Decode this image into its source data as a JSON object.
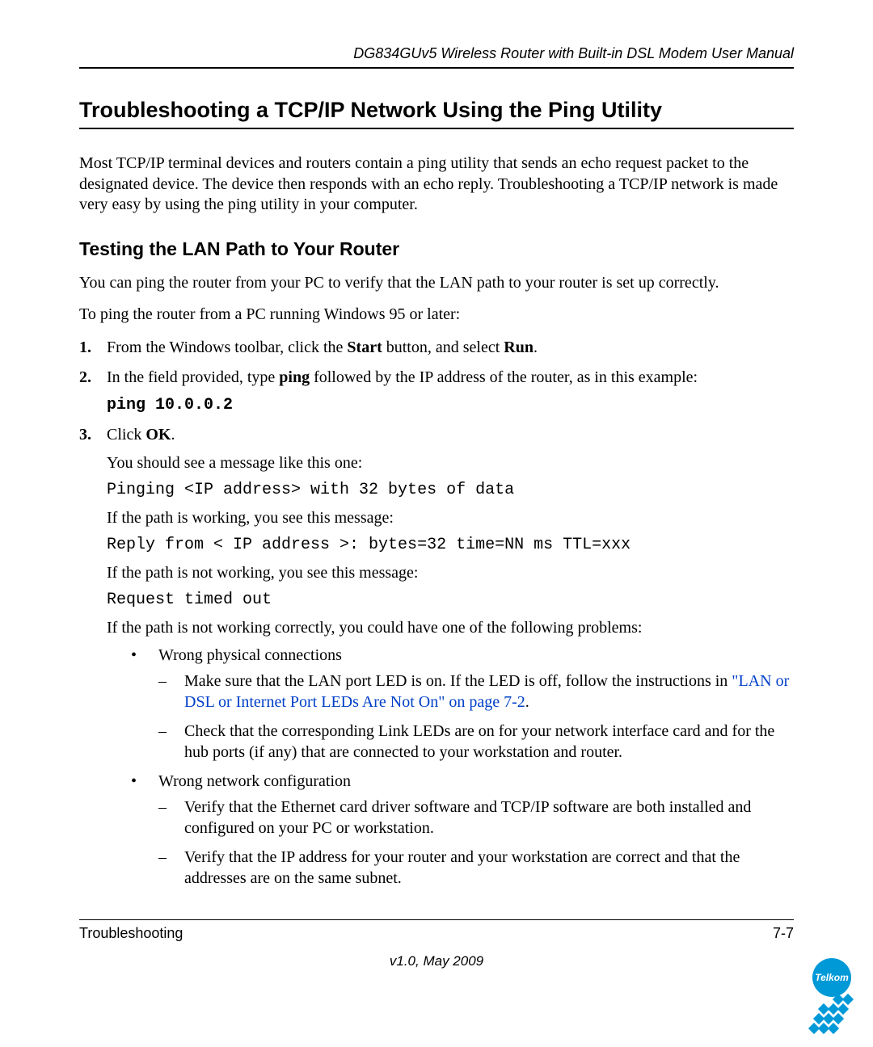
{
  "header": {
    "running_title": "DG834GUv5 Wireless Router with Built-in DSL Modem User Manual"
  },
  "section": {
    "title": "Troubleshooting a TCP/IP Network Using the Ping Utility",
    "intro": "Most TCP/IP terminal devices and routers contain a ping utility that sends an echo request packet to the designated device. The device then responds with an echo reply. Troubleshooting a TCP/IP network is made very easy by using the ping utility in your computer."
  },
  "subsection": {
    "title": "Testing the LAN Path to Your Router",
    "p1": "You can ping the router from your PC to verify that the LAN path to your router is set up correctly.",
    "p2": "To ping the router from a PC running Windows 95 or later:"
  },
  "steps": {
    "s1_pre": "From the Windows toolbar, click the ",
    "s1_b1": "Start",
    "s1_mid": " button, and select ",
    "s1_b2": "Run",
    "s1_post": ".",
    "s2_pre": "In the field provided, type ",
    "s2_b1": "ping",
    "s2_post": " followed by the IP address of the router, as in this example:",
    "s2_code": "ping 10.0.0.2",
    "s3_pre": "Click ",
    "s3_b1": "OK",
    "s3_post": ".",
    "s3_p1": "You should see a message like this one:",
    "s3_code1": "Pinging <IP address> with 32 bytes of data",
    "s3_p2": "If the path is working, you see this message:",
    "s3_code2": "Reply from < IP address >: bytes=32 time=NN ms TTL=xxx",
    "s3_p3": "If the path is not working, you see this message:",
    "s3_code3": "Request timed out",
    "s3_p4": "If the path is not working correctly, you could have one of the following problems:"
  },
  "bullets": {
    "b1": "Wrong physical connections",
    "b1_d1_pre": "Make sure that the LAN port LED is on. If the LED is off, follow the instructions in ",
    "b1_d1_link": "\"LAN or DSL or Internet Port LEDs Are Not On\" on page 7-2",
    "b1_d1_post": ".",
    "b1_d2": "Check that the corresponding Link LEDs are on for your network interface card and for the hub ports (if any) that are connected to your workstation and router.",
    "b2": "Wrong network configuration",
    "b2_d1": "Verify that the Ethernet card driver software and TCP/IP software are both installed and configured on your PC or workstation.",
    "b2_d2": "Verify that the IP address for your router and your workstation are correct and that the addresses are on the same subnet."
  },
  "footer": {
    "chapter": "Troubleshooting",
    "page": "7-7",
    "version": "v1.0, May 2009"
  },
  "logo": {
    "label": "Telkom"
  }
}
